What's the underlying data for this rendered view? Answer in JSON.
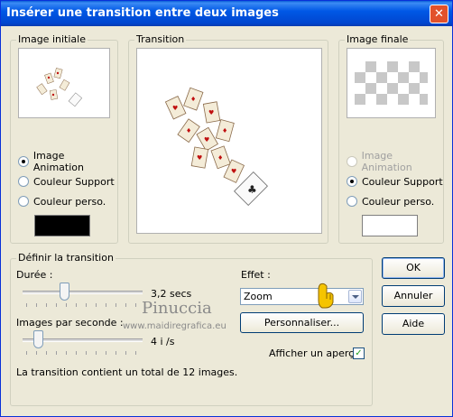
{
  "window": {
    "title": "Insérer une transition entre deux images",
    "close": "✕"
  },
  "initial": {
    "label": "Image initiale",
    "options": [
      {
        "label": "Image Animation",
        "selected": true,
        "disabled": false
      },
      {
        "label": "Couleur Support",
        "selected": false,
        "disabled": false
      },
      {
        "label": "Couleur perso.",
        "selected": false,
        "disabled": false
      }
    ],
    "swatch_color": "#000000"
  },
  "transition": {
    "label": "Transition"
  },
  "final": {
    "label": "Image finale",
    "options": [
      {
        "label": "Image Animation",
        "selected": false,
        "disabled": true
      },
      {
        "label": "Couleur Support",
        "selected": true,
        "disabled": false
      },
      {
        "label": "Couleur perso.",
        "selected": false,
        "disabled": false
      }
    ],
    "swatch_color": "#ffffff"
  },
  "define": {
    "label": "Définir la transition",
    "duration_label": "Durée :",
    "duration_value": "3,2 secs",
    "fps_label": "Images par seconde :",
    "fps_value": "4 i /s",
    "effect_label": "Effet :",
    "effect_value": "Zoom",
    "customize_label": "Personnaliser...",
    "preview_label": "Afficher un aperçu",
    "preview_checked": "✓",
    "summary": "La transition contient un total de 12 images."
  },
  "buttons": {
    "ok": "OK",
    "cancel": "Annuler",
    "help": "Aide"
  },
  "watermark": {
    "line1": "Pinuccia",
    "line2": "www.maidiregrafica.eu"
  }
}
